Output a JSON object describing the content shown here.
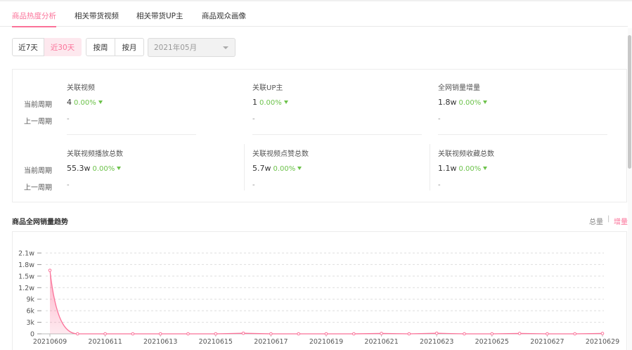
{
  "tabs": [
    {
      "label": "商品热度分析",
      "active": true
    },
    {
      "label": "相关带货视频",
      "active": false
    },
    {
      "label": "相关带货UP主",
      "active": false
    },
    {
      "label": "商品观众画像",
      "active": false
    }
  ],
  "period_range": {
    "options": [
      "近7天",
      "近30天"
    ],
    "selected": "近30天"
  },
  "granularity": {
    "options": [
      "按周",
      "按月"
    ]
  },
  "month_select": {
    "value": "2021年05月"
  },
  "stats": {
    "row_current": "当前周期",
    "row_previous": "上一周期",
    "metrics": [
      {
        "title": "关联视频",
        "value": "4",
        "change": "0.00%",
        "previous": "-"
      },
      {
        "title": "关联UP主",
        "value": "1",
        "change": "0.00%",
        "previous": "-"
      },
      {
        "title": "全网销量增量",
        "value": "1.8w",
        "change": "0.00%",
        "previous": "-"
      },
      {
        "title": "关联视频播放总数",
        "value": "55.3w",
        "change": "0.00%",
        "previous": "-"
      },
      {
        "title": "关联视频点赞总数",
        "value": "5.7w",
        "change": "0.00%",
        "previous": "-"
      },
      {
        "title": "关联视频收藏总数",
        "value": "1.1w",
        "change": "0.00%",
        "previous": "-"
      }
    ]
  },
  "trend": {
    "title": "商品全网销量趋势",
    "toggle_total": "总量",
    "toggle_separator": "|",
    "toggle_increment": "增量"
  },
  "colors": {
    "accent": "#fb7299",
    "positive": "#6cc24a"
  },
  "chart_data": {
    "type": "area",
    "y_ticks": [
      "0",
      "3k",
      "6k",
      "9k",
      "1.2w",
      "1.5w",
      "1.8w",
      "2.1w"
    ],
    "ylim": [
      0,
      21000
    ],
    "x_tick_labels": [
      "20210609",
      "20210611",
      "20210613",
      "20210615",
      "20210617",
      "20210619",
      "20210621",
      "20210623",
      "20210625",
      "20210627",
      "20210629"
    ],
    "x": [
      "20210609",
      "20210610",
      "20210611",
      "20210612",
      "20210613",
      "20210614",
      "20210615",
      "20210616",
      "20210617",
      "20210618",
      "20210619",
      "20210620",
      "20210621",
      "20210622",
      "20210623",
      "20210624",
      "20210625",
      "20210626",
      "20210627",
      "20210628",
      "20210629"
    ],
    "values": [
      16500,
      0,
      0,
      0,
      0,
      0,
      0,
      150,
      0,
      0,
      0,
      0,
      100,
      0,
      150,
      0,
      0,
      100,
      0,
      0,
      100
    ],
    "grid": true
  }
}
